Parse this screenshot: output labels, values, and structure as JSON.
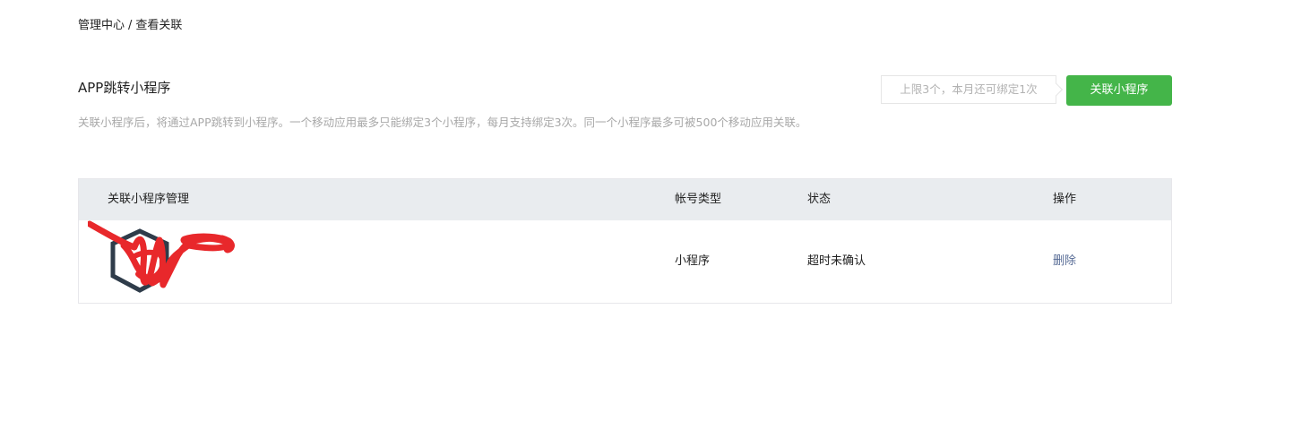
{
  "breadcrumb": {
    "root": "管理中心",
    "separator": "/",
    "current": "查看关联"
  },
  "section": {
    "title": "APP跳转小程序",
    "description": "关联小程序后，将通过APP跳转到小程序。一个移动应用最多只能绑定3个小程序，每月支持绑定3次。同一个小程序最多可被500个移动应用关联。",
    "limit_tip": "上限3个，本月还可绑定1次",
    "bind_button": "关联小程序"
  },
  "table": {
    "headers": [
      "关联小程序管理",
      "帐号类型",
      "状态",
      "操作"
    ],
    "rows": [
      {
        "account_type": "小程序",
        "status": "超时未确认",
        "action": "删除"
      }
    ]
  },
  "colors": {
    "primary": "#44b549",
    "link": "#576b95",
    "header_bg": "#e9ecef",
    "redaction": "#e8282b"
  }
}
